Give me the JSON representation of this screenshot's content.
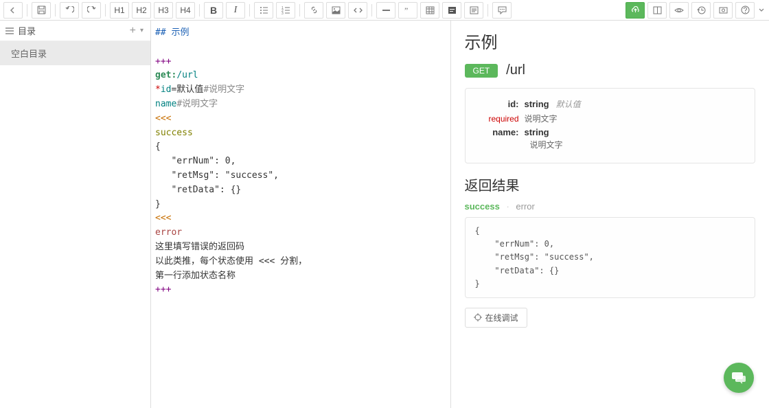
{
  "toolbar": {
    "h1": "H1",
    "h2": "H2",
    "h3": "H3",
    "h4": "H4",
    "bold": "B",
    "italic": "I"
  },
  "sidebar": {
    "title": "目录",
    "items": [
      {
        "label": "空白目录"
      }
    ]
  },
  "editor": {
    "lines": {
      "l0": "## 示例",
      "l1": "+++",
      "l2a": "get:",
      "l2b": "/url",
      "l3a": "*",
      "l3b": "id",
      "l3c": "=默认值",
      "l3d": "#说明文字",
      "l4a": "name",
      "l4b": "#说明文字",
      "l5": "<<<",
      "l6": "success",
      "l7": "{",
      "l8": "   \"errNum\": 0,",
      "l9": "   \"retMsg\": \"success\",",
      "l10": "   \"retData\": {}",
      "l11": "}",
      "l12": "<<<",
      "l13": "error",
      "l14": "这里填写错误的返回码",
      "l15": "以此类推，每个状态使用 <<< 分割，",
      "l16": "第一行添加状态名称",
      "l17": "+++"
    }
  },
  "preview": {
    "title": "示例",
    "method": "GET",
    "url": "/url",
    "params": {
      "p1": {
        "key": "id:",
        "required": "required",
        "type": "string",
        "default": "默认值",
        "desc": "说明文字"
      },
      "p2": {
        "key": "name:",
        "type": "string",
        "desc": "说明文字"
      }
    },
    "result_title": "返回结果",
    "status_active": "success",
    "status_inactive": "error",
    "code": "{\n    \"errNum\": 0,\n    \"retMsg\": \"success\",\n    \"retData\": {}\n}",
    "debug_label": "在线调试"
  }
}
